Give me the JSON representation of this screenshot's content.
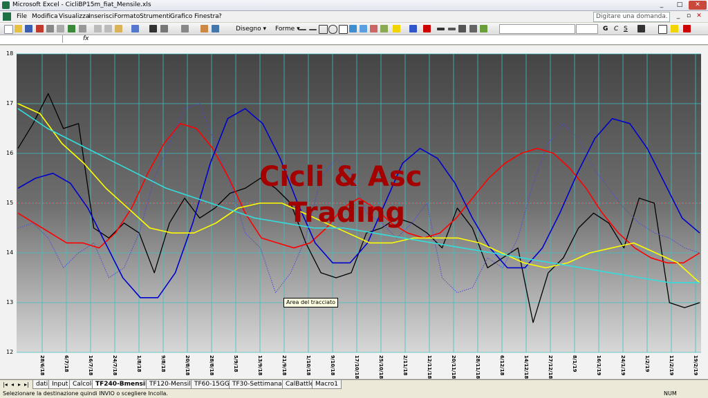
{
  "window": {
    "title": "Microsoft Excel - CicliBP15m_fiat_Mensile.xls",
    "minimize": "_",
    "maximize": "□",
    "close": "✕"
  },
  "menu": {
    "items": [
      "File",
      "Modifica",
      "Visualizza",
      "Inserisci",
      "Formato",
      "Strumenti",
      "Grafico",
      "Finestra",
      "?"
    ],
    "help_placeholder": "Digitare una domanda."
  },
  "toolbar": {
    "draw_label": "Disegno ▾",
    "shapes_label": "Forme ▾"
  },
  "formula": {
    "fx": "fx"
  },
  "chart_data": {
    "type": "line",
    "title": "",
    "ylim": [
      12,
      18
    ],
    "yticks": [
      12,
      13,
      14,
      15,
      16,
      17,
      18
    ],
    "x_tick_labels": [
      "28/6/18",
      "6/7/18",
      "16/7/18",
      "24/7/18",
      "1/8/18",
      "9/8/18",
      "20/8/18",
      "28/8/18",
      "5/9/18",
      "13/9/18",
      "21/9/18",
      "1/10/18",
      "9/10/18",
      "17/10/18",
      "25/10/18",
      "2/11/18",
      "12/11/18",
      "20/11/18",
      "28/11/18",
      "6/12/18",
      "14/12/18",
      "27/12/18",
      "8/1/19",
      "16/1/19",
      "24/1/19",
      "1/2/19",
      "11/2/19",
      "19/2/19"
    ],
    "grid": true,
    "reference_line": 15,
    "series": [
      {
        "color": "#000000",
        "style": "solid",
        "values": [
          16.1,
          16.6,
          17.2,
          16.5,
          16.6,
          14.5,
          14.3,
          14.6,
          14.4,
          13.6,
          14.6,
          15.1,
          14.7,
          14.9,
          15.2,
          15.3,
          15.5,
          15.3,
          15.0,
          14.2,
          13.6,
          13.5,
          13.6,
          14.4,
          14.5,
          14.7,
          14.6,
          14.4,
          14.1,
          14.9,
          14.5,
          13.7,
          13.9,
          14.1,
          12.6,
          13.6,
          13.9,
          14.5,
          14.8,
          14.6,
          14.1,
          15.1,
          15.0,
          13.0,
          12.9,
          13.0
        ]
      },
      {
        "color": "#4a4ad8",
        "style": "dotted",
        "values": [
          14.5,
          14.6,
          14.3,
          13.7,
          14.0,
          14.2,
          13.5,
          13.7,
          14.4,
          15.5,
          16.2,
          16.9,
          17.0,
          16.2,
          15.4,
          14.4,
          14.1,
          13.2,
          13.6,
          14.3,
          15.5,
          15.9,
          15.6,
          14.8,
          14.6,
          14.3,
          14.6,
          15.0,
          13.5,
          13.2,
          13.3,
          13.9,
          13.7,
          14.3,
          15.4,
          16.2,
          16.6,
          16.3,
          15.7,
          15.3,
          14.9,
          14.6,
          14.4,
          14.3,
          14.1,
          14.0
        ]
      },
      {
        "color": "#ff0000",
        "style": "solid",
        "values": [
          14.8,
          14.6,
          14.4,
          14.2,
          14.2,
          14.1,
          14.4,
          14.9,
          15.6,
          16.2,
          16.6,
          16.5,
          16.1,
          15.5,
          14.8,
          14.3,
          14.2,
          14.1,
          14.2,
          14.5,
          14.9,
          15.1,
          14.9,
          14.6,
          14.4,
          14.3,
          14.4,
          14.7,
          15.1,
          15.5,
          15.8,
          16.0,
          16.1,
          16.0,
          15.7,
          15.3,
          14.8,
          14.4,
          14.1,
          13.9,
          13.8,
          13.8,
          14.0
        ]
      },
      {
        "color": "#0000cc",
        "style": "solid",
        "values": [
          15.3,
          15.5,
          15.6,
          15.4,
          14.9,
          14.2,
          13.5,
          13.1,
          13.1,
          13.6,
          14.6,
          15.8,
          16.7,
          16.9,
          16.6,
          15.9,
          15.0,
          14.2,
          13.8,
          13.8,
          14.2,
          15.0,
          15.8,
          16.1,
          15.9,
          15.4,
          14.7,
          14.1,
          13.7,
          13.7,
          14.1,
          14.8,
          15.6,
          16.3,
          16.7,
          16.6,
          16.1,
          15.4,
          14.7,
          14.4
        ]
      },
      {
        "color": "#ffff00",
        "style": "solid",
        "values": [
          17.0,
          16.8,
          16.2,
          15.8,
          15.3,
          14.9,
          14.5,
          14.4,
          14.4,
          14.6,
          14.9,
          15.0,
          15.0,
          14.8,
          14.6,
          14.4,
          14.2,
          14.2,
          14.3,
          14.3,
          14.3,
          14.2,
          14.0,
          13.8,
          13.7,
          13.8,
          14.0,
          14.1,
          14.2,
          14.0,
          13.8,
          13.4
        ]
      },
      {
        "color": "#33dddd",
        "style": "solid",
        "values": [
          16.9,
          16.5,
          16.2,
          15.9,
          15.6,
          15.3,
          15.1,
          14.9,
          14.7,
          14.6,
          14.5,
          14.5,
          14.4,
          14.3,
          14.2,
          14.1,
          14.0,
          13.9,
          13.8,
          13.7,
          13.6,
          13.5,
          13.4,
          13.4
        ]
      }
    ]
  },
  "watermark": {
    "line1": "Cicli & Asc",
    "line2": "Trading"
  },
  "tooltip": "Area del tracciato",
  "sheet_tabs": [
    "dati",
    "Input",
    "Calcolo",
    "TF240-Bmensile",
    "TF120-Mensile",
    "TF60-15GG",
    "TF30-Settimanale",
    "CalBattle",
    "Macro1"
  ],
  "status": {
    "message": "Selezionare la destinazione quindi INVIO o scegliere Incolla.",
    "num": "NUM"
  }
}
